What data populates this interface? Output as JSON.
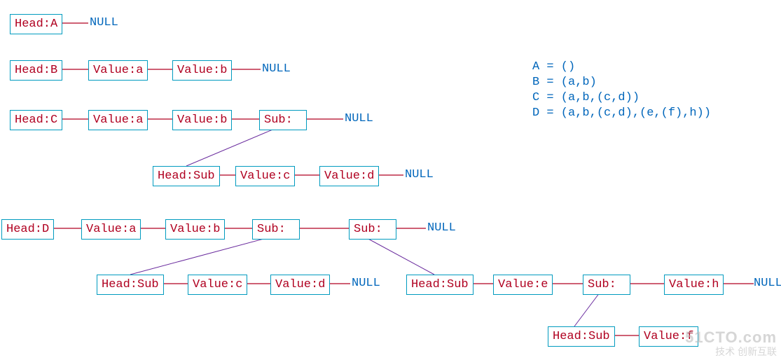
{
  "definitions": {
    "A": "A = ()",
    "B": "B = (a,b)",
    "C": "C = (a,b,(c,d))",
    "D": "D = (a,b,(c,d),(e,(f),h))"
  },
  "labels": {
    "headA": "Head:A",
    "headB": "Head:B",
    "headC": "Head:C",
    "headD": "Head:D",
    "headSub": "Head:Sub",
    "valueA": "Value:a",
    "valueB": "Value:b",
    "valueC": "Value:c",
    "valueD": "Value:d",
    "valueE": "Value:e",
    "valueH": "Value:h",
    "valueF": "Value:f",
    "sub": "Sub:",
    "null": "NULL"
  },
  "lists": {
    "A": {
      "head": "A",
      "items": []
    },
    "B": {
      "head": "B",
      "items": [
        "a",
        "b"
      ]
    },
    "C": {
      "head": "C",
      "items": [
        "a",
        "b",
        {
          "sub": [
            "c",
            "d"
          ]
        }
      ]
    },
    "D": {
      "head": "D",
      "items": [
        "a",
        "b",
        {
          "sub": [
            "c",
            "d"
          ]
        },
        {
          "sub": [
            "e",
            {
              "sub": [
                "f"
              ]
            },
            "h"
          ]
        }
      ]
    }
  },
  "watermark": {
    "line1": "51CTO.com",
    "line2": "技术  创新互联"
  }
}
